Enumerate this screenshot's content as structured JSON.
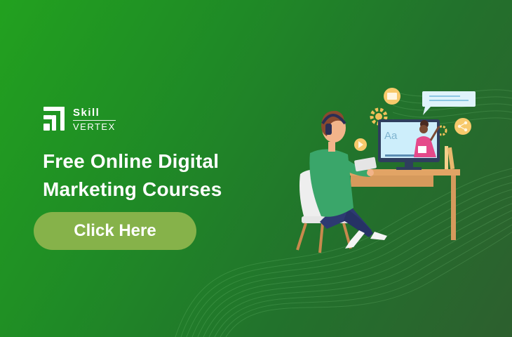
{
  "brand": {
    "name_top": "Skill",
    "name_bottom": "VERTEX"
  },
  "headline": {
    "line1": "Free Online Digital",
    "line2": "Marketing Courses"
  },
  "cta": {
    "label": "Click Here"
  },
  "illustration": {
    "screen_text": "Aa"
  },
  "colors": {
    "background_start": "#22a11f",
    "background_end": "#2d5f2e",
    "cta_bg": "#86b24a",
    "text": "#ffffff"
  }
}
